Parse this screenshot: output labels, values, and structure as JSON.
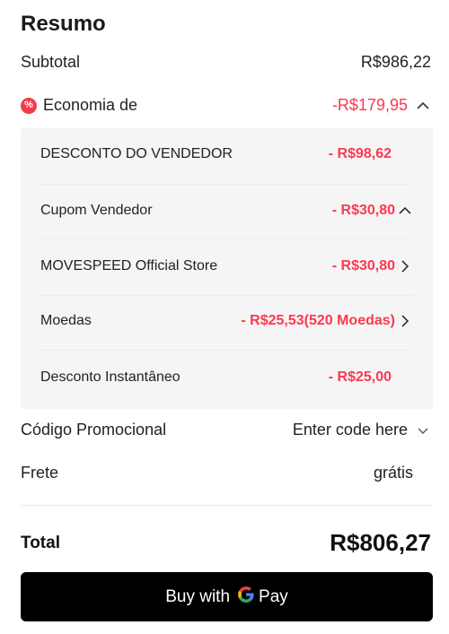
{
  "summary": {
    "title": "Resumo",
    "subtotal_label": "Subtotal",
    "subtotal_value": "R$986,22",
    "savings_label": "Economia de",
    "savings_value": "-R$179,95",
    "savings_badge": "%",
    "discounts": [
      {
        "label": "DESCONTO DO VENDEDOR",
        "value": "- R$98,62"
      },
      {
        "label": "Cupom Vendedor",
        "value": "- R$30,80"
      },
      {
        "label": "MOVESPEED Official Store",
        "value": "- R$30,80"
      },
      {
        "label": "Moedas",
        "value": "- R$25,53(520 Moedas)"
      },
      {
        "label": "Desconto Instantâneo",
        "value": "- R$25,00"
      }
    ],
    "promo_label": "Código Promocional",
    "promo_placeholder": "Enter code here",
    "shipping_label": "Frete",
    "shipping_value": "grátis",
    "total_label": "Total",
    "total_value": "R$806,27"
  },
  "pay_button": {
    "prefix": "Buy with",
    "brand_g": "G",
    "brand_pay": "Pay"
  },
  "colors": {
    "accent_red": "#fd384f",
    "panel_bg": "#f5f5f5",
    "button_bg": "#000000"
  },
  "icons": {
    "savings": "discount-badge-icon",
    "expand": "chevron-up-icon",
    "navigate": "chevron-right-icon",
    "dropdown": "chevron-down-icon",
    "google": "google-g-icon"
  }
}
